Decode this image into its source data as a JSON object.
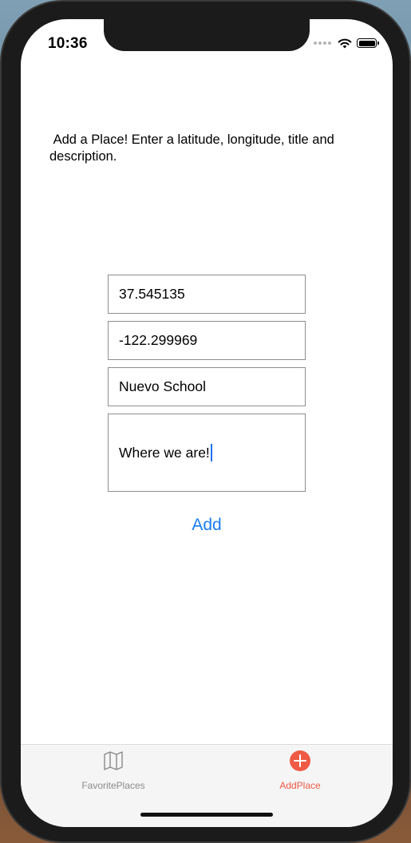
{
  "status_bar": {
    "time": "10:36"
  },
  "instructions": " Add a Place! Enter a latitude, longitude, title and\ndescription.",
  "form": {
    "latitude": "37.545135",
    "longitude": "-122.299969",
    "title": "Nuevo School",
    "description": "Where we are!",
    "add_label": "Add"
  },
  "tab_bar": {
    "tabs": [
      {
        "label": "FavoritePlaces",
        "icon": "map-icon",
        "selected": false
      },
      {
        "label": "AddPlace",
        "icon": "plus-circle-icon",
        "selected": true
      }
    ]
  },
  "colors": {
    "accent": "#1a7cf3",
    "tab_selected": "#ee5a45",
    "tab_unselected": "#8a8a8a"
  }
}
